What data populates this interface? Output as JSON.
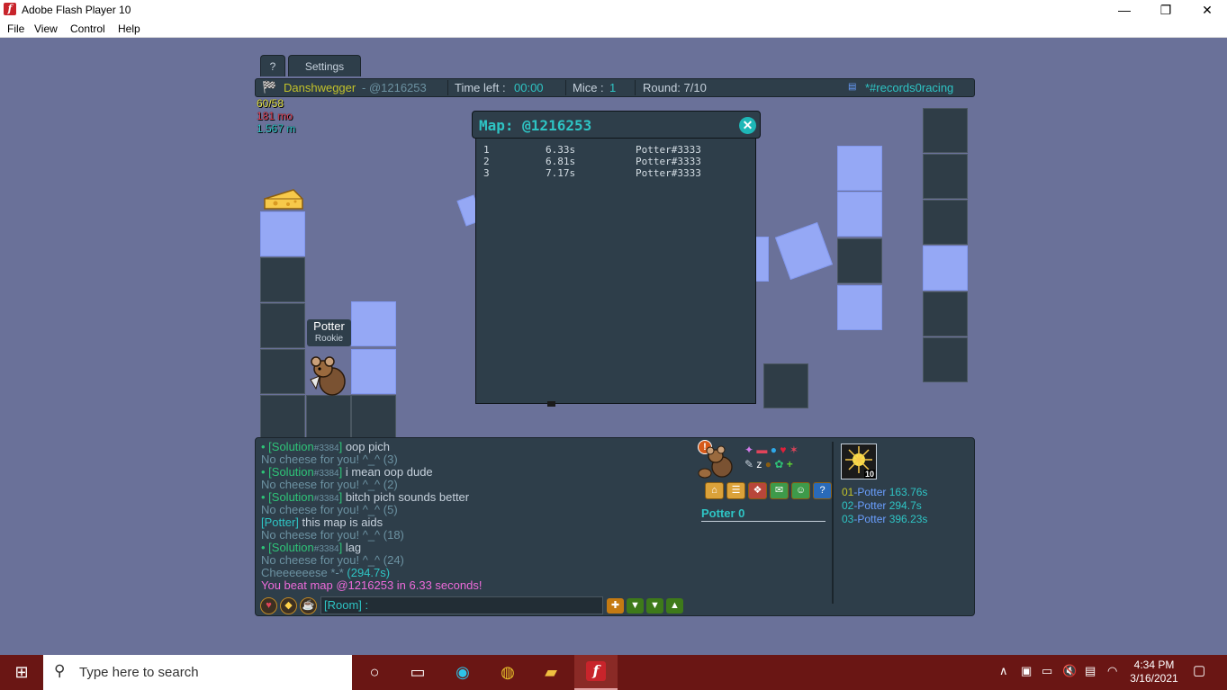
{
  "window": {
    "title": "Adobe Flash Player 10",
    "minimize": "—",
    "restore": "❐",
    "close": "✕"
  },
  "menu": [
    "File",
    "View",
    "Control",
    "Help"
  ],
  "tabs": {
    "help": "?",
    "settings": "Settings"
  },
  "topbar": {
    "room_icon": "▤",
    "player": "Danshwegger",
    "map": "- @1216253",
    "time_label": "Time left :",
    "time_value": "00:00",
    "mice_label": "Mice :",
    "mice_value": "1",
    "round_label": "Round: 7/10",
    "room": "*#records0racing"
  },
  "stats": {
    "lives": "60/58",
    "mo": "181 mo",
    "m": "1.567 m"
  },
  "nametag": {
    "name": "Potter",
    "title": "Rookie"
  },
  "map_popup": {
    "title": "Map: @1216253",
    "close": "✕",
    "rows": [
      {
        "rank": "1",
        "time": "6.33s",
        "player": "Potter#3333"
      },
      {
        "rank": "2",
        "time": "6.81s",
        "player": "Potter#3333"
      },
      {
        "rank": "3",
        "time": "7.17s",
        "player": "Potter#3333"
      }
    ]
  },
  "chat": [
    {
      "bullet": "• ",
      "tag": "[Solution",
      "tagid": "#3384",
      "close": "] ",
      "text": "oop pich"
    },
    {
      "system": "No cheese for you! ^_^ (3)"
    },
    {
      "bullet": "• ",
      "tag": "[Solution",
      "tagid": "#3384",
      "close": "] ",
      "text": "i mean oop dude"
    },
    {
      "system": "No cheese for you! ^_^ (2)"
    },
    {
      "bullet": "• ",
      "tag": "[Solution",
      "tagid": "#3384",
      "close": "] ",
      "text": "bitch pich sounds better"
    },
    {
      "system": "No cheese for you! ^_^ (5)"
    },
    {
      "tag": "[Potter]",
      "text": " this map is aids"
    },
    {
      "system": "No cheese for you! ^_^ (18)"
    },
    {
      "bullet": "• ",
      "tag": "[Solution",
      "tagid": "#3384",
      "close": "] ",
      "text": "lag"
    },
    {
      "system": "No cheese for you! ^_^ (24)"
    },
    {
      "system": "Cheeeeeese *-* ",
      "extra": "(294.7s)"
    },
    {
      "highlight": "You beat map @1216253 in 6.33 seconds!"
    }
  ],
  "chat_input": {
    "value": "[Room] :"
  },
  "player_panel": {
    "name": "Potter 0",
    "avatar_level": "10"
  },
  "ranks": [
    {
      "pos": "01",
      "name": "-Potter",
      "time": " 163.76s"
    },
    {
      "pos": "02",
      "name": "-Potter",
      "time": " 294.7s"
    },
    {
      "pos": "03",
      "name": "-Potter",
      "time": " 396.23s"
    }
  ],
  "taskbar": {
    "search_placeholder": "Type here to search",
    "time": "4:34 PM",
    "date": "3/16/2021"
  },
  "colors": {
    "background": "#6a7199",
    "panel": "#2e3e4a",
    "taskbar": "#6a1614",
    "accent": "#2ec4c4"
  }
}
